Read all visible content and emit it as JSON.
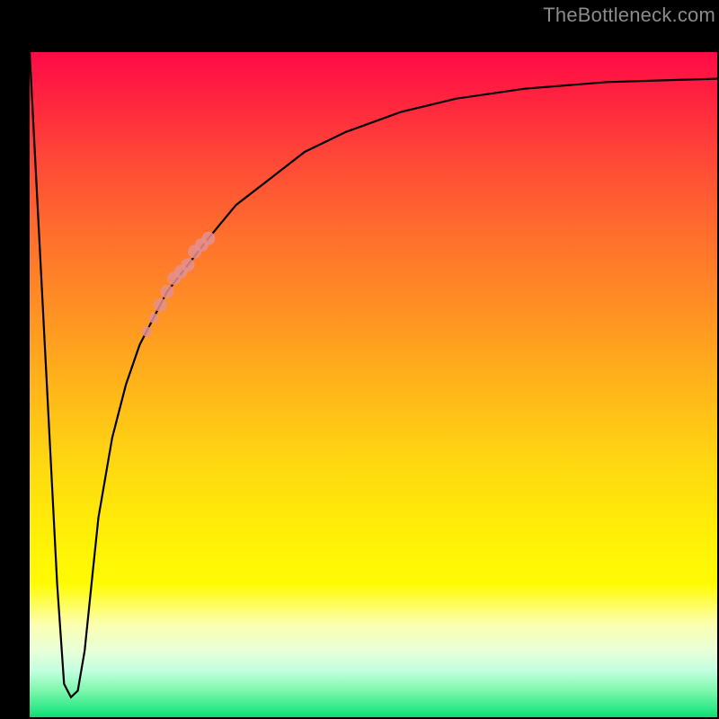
{
  "watermark": {
    "text": "TheBottleneck.com"
  },
  "chart_data": {
    "type": "line",
    "title": "",
    "xlabel": "",
    "ylabel": "",
    "xlim": [
      0,
      100
    ],
    "ylim": [
      0,
      100
    ],
    "grid": false,
    "background_gradient": {
      "direction": "vertical",
      "stops": [
        {
          "pos": 0.0,
          "color": "#ff0a46"
        },
        {
          "pos": 0.5,
          "color": "#ffb41a"
        },
        {
          "pos": 0.8,
          "color": "#fffb04"
        },
        {
          "pos": 0.93,
          "color": "#c2ffdf"
        },
        {
          "pos": 1.0,
          "color": "#10d872"
        }
      ]
    },
    "series": [
      {
        "name": "bottleneck-curve",
        "color": "#000000",
        "x": [
          0,
          2,
          4,
          5,
          6,
          7,
          8,
          9,
          10,
          12,
          14,
          16,
          18,
          20,
          23,
          26,
          30,
          35,
          40,
          46,
          54,
          62,
          72,
          84,
          100
        ],
        "y": [
          100,
          60,
          20,
          5,
          3,
          4,
          10,
          20,
          30,
          42,
          50,
          56,
          60,
          64,
          68,
          72,
          77,
          81,
          85,
          88,
          91,
          93,
          94.5,
          95.5,
          96
        ]
      }
    ],
    "highlight_segment": {
      "note": "thick muted-pink dots along curve",
      "color": "#e58f8f",
      "x": [
        17,
        18,
        19,
        20,
        21,
        22,
        23,
        24,
        25,
        26
      ],
      "y": [
        58,
        60,
        62,
        64,
        66,
        67,
        68,
        70,
        71,
        72
      ]
    }
  }
}
